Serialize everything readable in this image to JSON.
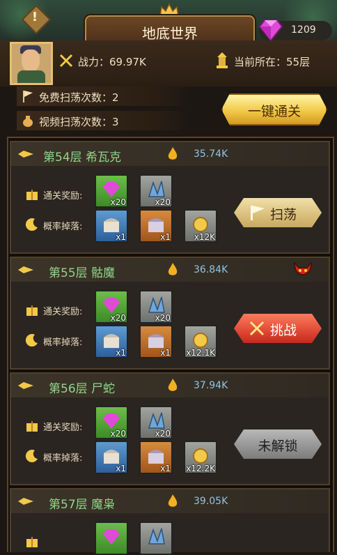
{
  "header": {
    "title": "地底世界",
    "alert_glyph": "!",
    "gems": "1209"
  },
  "player": {
    "power_label": "战力：69.97K",
    "current_floor_label": "当前所在：55层"
  },
  "sweep": {
    "free_label": "免费扫荡次数：2",
    "video_label": "视频扫荡次数：3",
    "one_key_label": "一键通关"
  },
  "labels": {
    "clear_reward": "通关奖励:",
    "drop": "概率掉落:"
  },
  "floors": [
    {
      "name": "第54层  希瓦克",
      "power": "35.74K",
      "rewards": [
        "x20",
        "x20"
      ],
      "drops": [
        "x1",
        "x1",
        "x12K"
      ],
      "action": "扫荡",
      "action_type": "sweep",
      "boss_icon": false
    },
    {
      "name": "第55层  骷魔",
      "power": "36.84K",
      "rewards": [
        "x20",
        "x20"
      ],
      "drops": [
        "x1",
        "x1",
        "x12.1K"
      ],
      "action": "挑战",
      "action_type": "challenge",
      "boss_icon": true
    },
    {
      "name": "第56层  尸蛇",
      "power": "37.94K",
      "rewards": [
        "x20",
        "x20"
      ],
      "drops": [
        "x1",
        "x1",
        "x12.2K"
      ],
      "action": "未解锁",
      "action_type": "locked",
      "boss_icon": false
    },
    {
      "name": "第57层  魔枭",
      "power": "39.05K",
      "rewards": [
        "",
        ""
      ],
      "drops": [],
      "action": "",
      "action_type": "none",
      "boss_icon": false
    }
  ],
  "colors": {
    "floor_name": "#8ed68a",
    "power": "#8fc4e6",
    "gold_button": "#f2c948",
    "challenge_button": "#c8281c",
    "locked_button": "#7c7c7c"
  }
}
